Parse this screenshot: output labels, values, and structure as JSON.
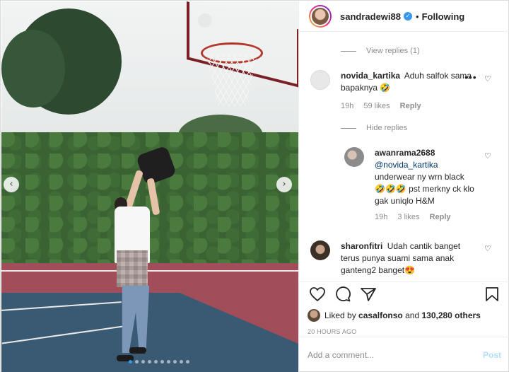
{
  "post": {
    "carousel": {
      "prev_glyph": "‹",
      "next_glyph": "›",
      "dot_count": 10,
      "active_dot": 0
    }
  },
  "header": {
    "username": "sandradewi88",
    "verified_glyph": "✓",
    "separator": "•",
    "follow_status": "Following"
  },
  "comments": {
    "view_replies_1": "View replies (1)",
    "c1": {
      "user": "novida_kartika",
      "text_line1": "Aduh salfok sama",
      "text_line2": "bapaknya 🤣",
      "time": "19h",
      "likes": "59 likes",
      "reply": "Reply"
    },
    "hide_replies": "Hide replies",
    "c2": {
      "user": "awanrama2688",
      "mention": "@novida_kartika",
      "text_line1": "underwear ny wrn black",
      "text_line2": "🤣🤣🤣 pst merkny ck klo",
      "text_line3": "gak uniqlo H&M",
      "time": "19h",
      "likes": "3 likes",
      "reply": "Reply"
    },
    "c3": {
      "user": "sharonfitri",
      "text_line1": "Udah cantik banget",
      "text_line2": "terus punya suami sama anak",
      "text_line3": "ganteng2 banget😍"
    }
  },
  "actions": {
    "liked_by_prefix": "Liked by",
    "liked_by_user": "casalfonso",
    "and": "and",
    "others": "130,280 others",
    "timestamp": "20 HOURS AGO"
  },
  "add_comment": {
    "placeholder": "Add a comment...",
    "post_label": "Post"
  },
  "colors": {
    "accent": "#3897f0",
    "muted": "#8e8e8e",
    "link": "#00376b",
    "post_disabled": "#b2dffc"
  }
}
